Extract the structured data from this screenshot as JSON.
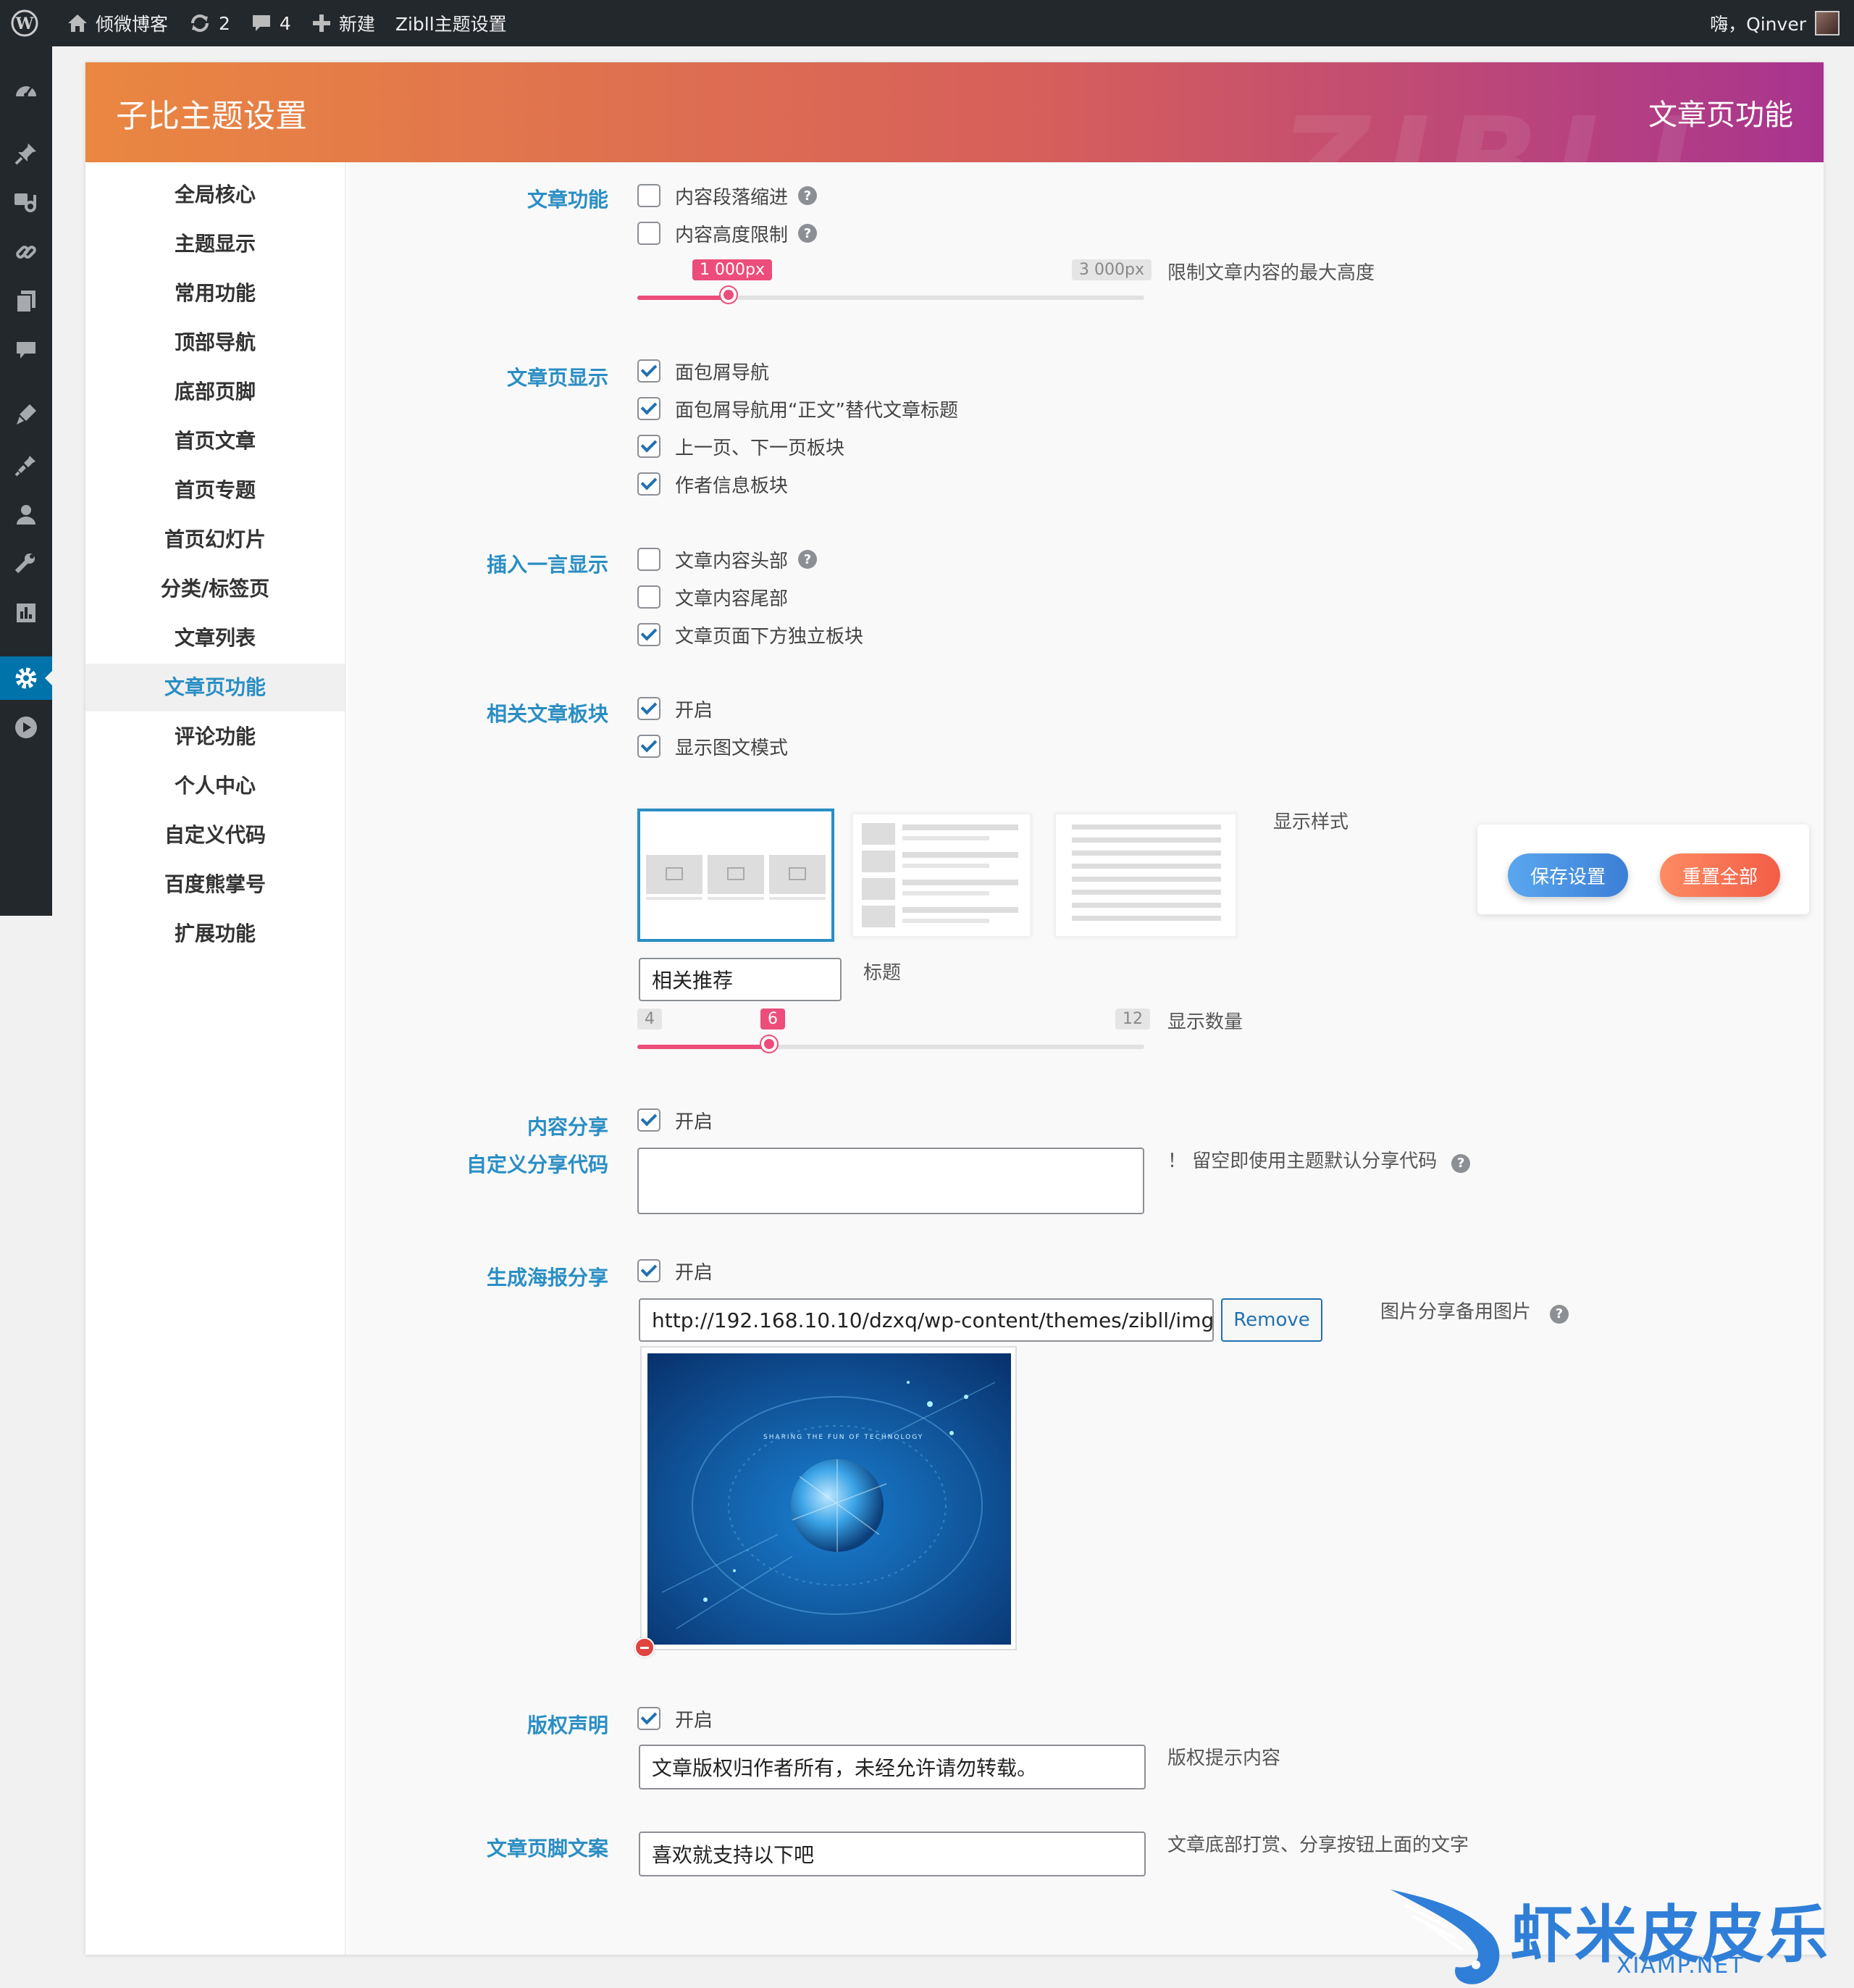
{
  "adminbar": {
    "site_name": "倾微博客",
    "updates_count": "2",
    "comments_count": "4",
    "new_label": "新建",
    "theme_settings_label": "Zibll主题设置",
    "greeting": "嗨，Qinver"
  },
  "header": {
    "title": "子比主题设置",
    "section": "文章页功能",
    "watermark": "ZIBLL"
  },
  "nav": {
    "items": [
      "全局核心",
      "主题显示",
      "常用功能",
      "顶部导航",
      "底部页脚",
      "首页文章",
      "首页专题",
      "首页幻灯片",
      "分类/标签页",
      "文章列表",
      "文章页功能",
      "评论功能",
      "个人中心",
      "自定义代码",
      "百度熊掌号",
      "扩展功能"
    ],
    "active_index": 10
  },
  "sections": {
    "article_func": {
      "label": "文章功能",
      "opt_indent": "内容段落缩进",
      "opt_height_limit": "内容高度限制",
      "slider_value_label": "1 000px",
      "slider_max_label": "3 000px",
      "slider_fraction": 0.18,
      "slider_desc": "限制文章内容的最大高度"
    },
    "article_display": {
      "label": "文章页显示",
      "opt_breadcrumb": "面包屑导航",
      "opt_breadcrumb_text": "面包屑导航用“正文”替代文章标题",
      "opt_prev_next": "上一页、下一页板块",
      "opt_author": "作者信息板块"
    },
    "hitokoto": {
      "label": "插入一言显示",
      "opt_head": "文章内容头部",
      "opt_tail": "文章内容尾部",
      "opt_bottom": "文章页面下方独立板块"
    },
    "related": {
      "label": "相关文章板块",
      "opt_enable": "开启",
      "opt_image_mode": "显示图文模式",
      "style_label": "显示样式",
      "title_value": "相关推荐",
      "title_label": "标题",
      "count_min": "4",
      "count_value": "6",
      "count_max": "12",
      "count_label": "显示数量",
      "count_fraction": 0.26
    },
    "share": {
      "label": "内容分享",
      "opt_enable": "开启",
      "custom_label": "自定义分享代码",
      "custom_desc": "！ 留空即使用主题默认分享代码"
    },
    "poster": {
      "label": "生成海报分享",
      "opt_enable": "开启",
      "url_value": "http://192.168.10.10/dzxq/wp-content/themes/zibll/img/share_img.jpg",
      "remove_label": "Remove",
      "desc": "图片分享备用图片",
      "image_caption": "SHARING THE FUN OF TECHNOLOGY"
    },
    "copyright": {
      "label": "版权声明",
      "opt_enable": "开启",
      "value": "文章版权归作者所有，未经允许请勿转载。",
      "desc": "版权提示内容"
    },
    "footer_text": {
      "label": "文章页脚文案",
      "value": "喜欢就支持以下吧",
      "desc": "文章底部打赏、分享按钮上面的文字"
    }
  },
  "actions": {
    "save": "保存设置",
    "reset": "重置全部"
  },
  "help_glyph": "?",
  "watermark": {
    "text": "虾米皮皮乐",
    "domain": "XIAMP.NET"
  },
  "colors": {
    "accent": "#2a8ec4",
    "slider": "#ec4d7a",
    "header_start": "#ea8741",
    "header_end": "#a8348f"
  }
}
